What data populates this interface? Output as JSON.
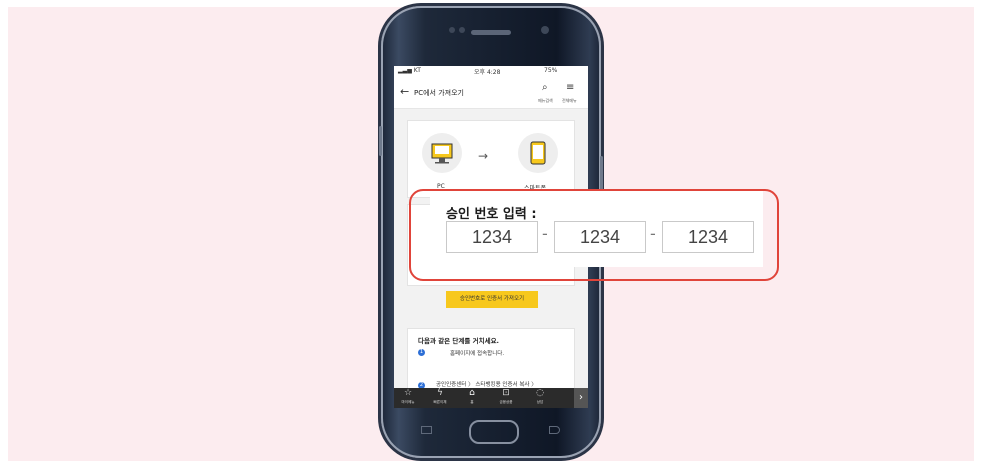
{
  "status_bar": {
    "carrier": "KT",
    "time": "오후 4:28",
    "battery": "75%"
  },
  "nav": {
    "back_icon": "arrow-left-icon",
    "title": "PC에서 가져오기",
    "search_label": "메뉴검색",
    "menu_label": "전체메뉴"
  },
  "transfer_card": {
    "pc_label": "PC",
    "phone_label": "스마트폰"
  },
  "approval": {
    "title": "승인 번호 입력 :",
    "codes": [
      "1234",
      "1234",
      "1234"
    ],
    "separator": "-"
  },
  "import_button": "승인번호로 인증서 가져오기",
  "steps": {
    "title": "다음과 같은 단계를 거치세요.",
    "items": [
      {
        "number": "1",
        "text": "홈페이지에 접속합니다."
      },
      {
        "number": "2",
        "text": "공인인증센터 〉 스타뱅킹용 인증서 복사 〉"
      }
    ]
  },
  "tabbar": {
    "items": [
      {
        "icon": "star-icon",
        "label": "마이메뉴"
      },
      {
        "icon": "lightning-icon",
        "label": "빠른이체"
      },
      {
        "icon": "home-icon",
        "label": "홈"
      },
      {
        "icon": "lock-icon",
        "label": "금융상품"
      },
      {
        "icon": "chat-icon",
        "label": "상담"
      }
    ],
    "next_icon": "chevron-right-icon"
  },
  "colors": {
    "background": "#fcecef",
    "highlight": "#e0443a",
    "accent_yellow": "#f7c81d",
    "step_blue": "#2d6fd6"
  }
}
